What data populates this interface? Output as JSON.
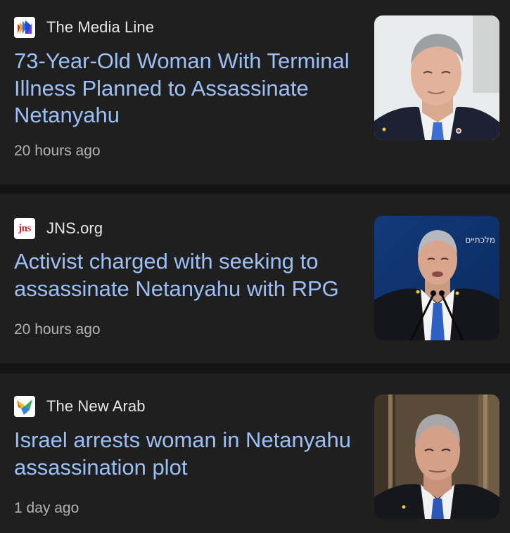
{
  "articles": [
    {
      "source": "The Media Line",
      "logo_icon": "media-line-logo",
      "headline": "73-Year-Old Woman With Terminal Illness Planned to Assassinate Netanyahu",
      "time": "20 hours ago"
    },
    {
      "source": "JNS.org",
      "logo_icon": "jns-logo",
      "logo_text": "jns",
      "headline": "Activist charged with seeking to assassinate Netanyahu with RPG",
      "time": "20 hours ago",
      "thumbnail_text": "מלכתיים"
    },
    {
      "source": "The New Arab",
      "logo_icon": "new-arab-logo",
      "headline": "Israel arrests woman in Netanyahu assassination plot",
      "time": "1 day ago"
    }
  ],
  "colors": {
    "background": "#1f1f20",
    "separator": "#141415",
    "headline": "#9cc0f5",
    "source": "#e6e6e6",
    "timestamp": "#b3b3b3"
  }
}
